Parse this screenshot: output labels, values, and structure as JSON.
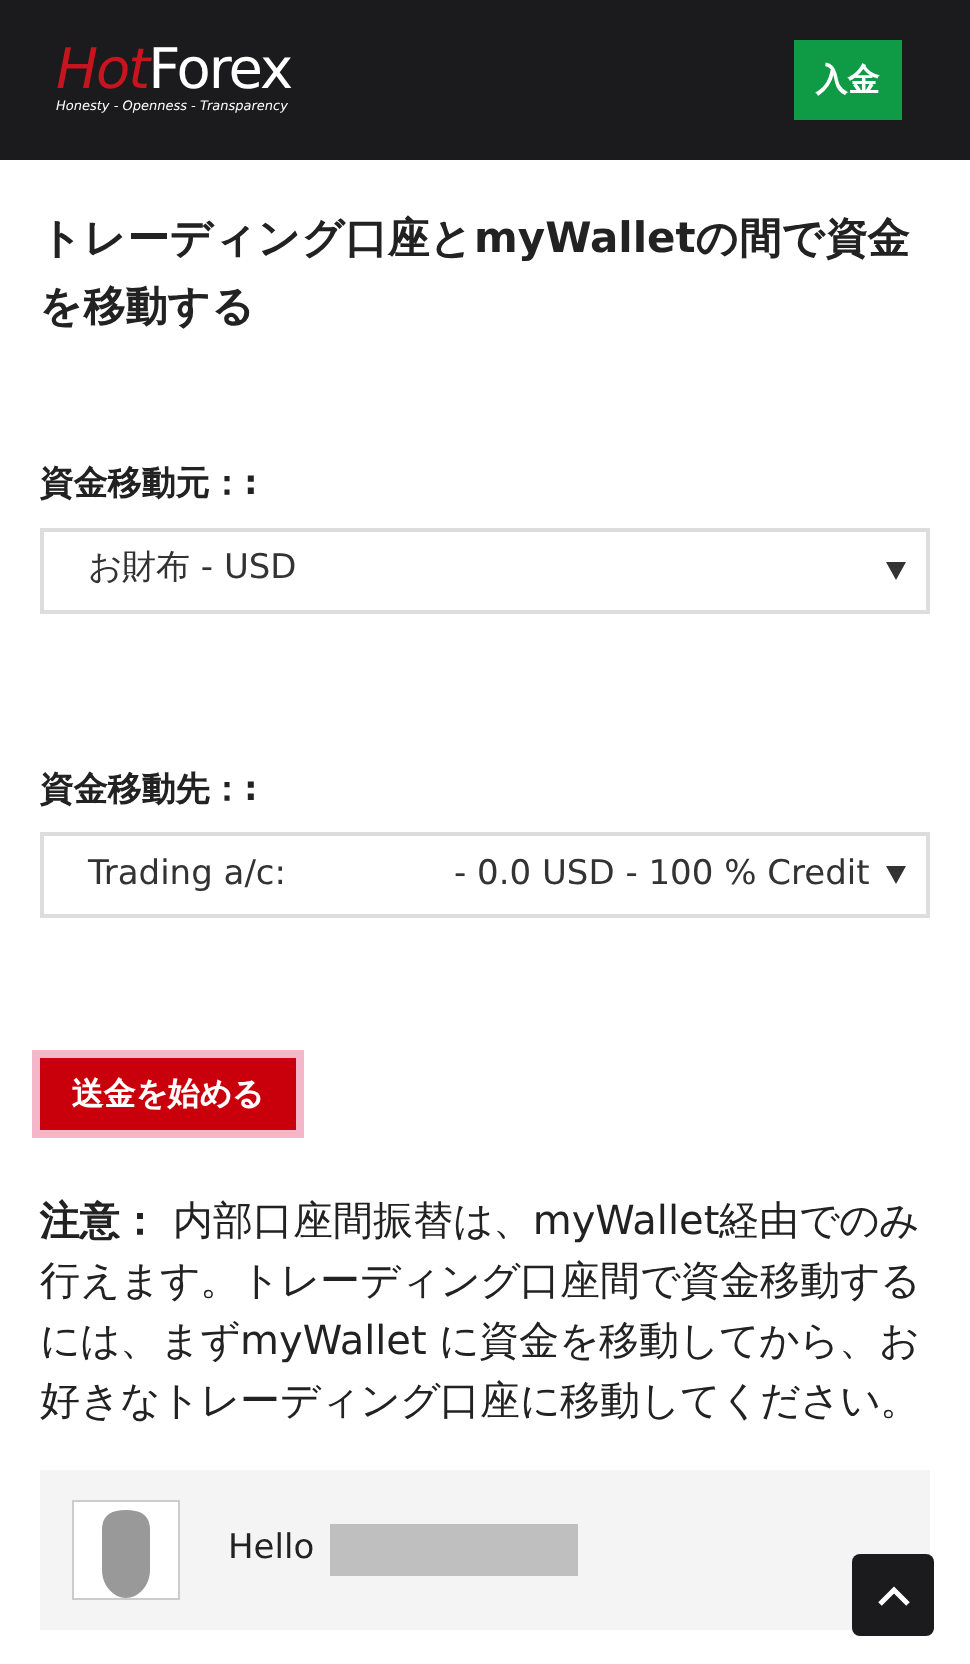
{
  "header": {
    "logo": {
      "part_1": "Hot",
      "part_2": "Forex",
      "tagline": "Honesty - Openness - Transparency"
    },
    "deposit_button": "入金"
  },
  "title": "トレーディング口座とmyWalletの間で資金を移動する",
  "from": {
    "label": "資金移動元：:",
    "value": "お財布 - USD"
  },
  "to": {
    "label": "資金移動先：:",
    "value": "Trading a/c:",
    "value_2": "- 0.0 USD - 100 % Credit"
  },
  "submit_button": "送金を始める",
  "note": "**注意：** 内部口座間振替は、myWallet経由でのみ行えます。トレーディング口座間で資金移動するには、まずmyWallet に資金を移動してから、お好きなトレーディング口座に移動してください。",
  "profile": {
    "greeting": "Hello"
  }
}
